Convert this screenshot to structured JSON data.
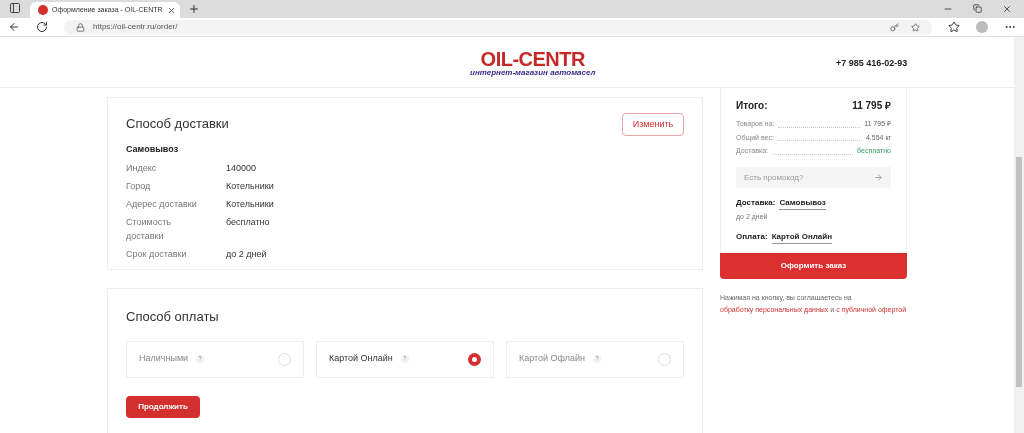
{
  "browser": {
    "tab_title": "Оформление заказа - OIL-CENTR",
    "url": "https://oil-centr.ru/order/"
  },
  "header": {
    "logo": "OIL-CENTR",
    "logo_tagline": "интернет-магазин автомасел",
    "phone": "+7 985 416-02-93"
  },
  "delivery": {
    "title": "Способ доставки",
    "change_button": "Изменить",
    "method": "Самовывоз",
    "rows": [
      {
        "label": "Индекс",
        "value": "140000"
      },
      {
        "label": "Город",
        "value": "Котельники"
      },
      {
        "label": "Адерес доставки",
        "value": "Котельники"
      },
      {
        "label": "Стоимость доставки",
        "value": "бесплатно"
      },
      {
        "label": "Срок доставки",
        "value": "до 2 дней"
      }
    ]
  },
  "payment": {
    "title": "Способ оплаты",
    "options": [
      {
        "label": "Наличными",
        "hint": "?",
        "selected": false
      },
      {
        "label": "Картой Онлайн",
        "hint": "?",
        "selected": true
      },
      {
        "label": "Картой Офлайн",
        "hint": "?",
        "selected": false
      }
    ],
    "continue_button": "Продолжить"
  },
  "summary": {
    "total_label": "Итого:",
    "total": "11 795 ₽",
    "lines": [
      {
        "label": "Товаров на:",
        "value": "11 795 ₽",
        "kind": "plain"
      },
      {
        "label": "Общий вес:",
        "value": "4.554 кг",
        "kind": "plain"
      },
      {
        "label": "Доставка:",
        "value": "бесплатно",
        "kind": "free"
      }
    ],
    "promo_placeholder": "Есть промокод?",
    "delivery_label": "Доставка:",
    "delivery_value": "Самовывоз",
    "delivery_term": "до 2 дней",
    "payment_label": "Оплата:",
    "payment_value": "Картой Онлайн",
    "order_button": "Оформить заказ",
    "consent_text": "Нажимая на кнопку, вы соглашаетесь на",
    "consent_link1": "обработку персональных данных",
    "consent_and": "и",
    "consent_link2": "с публичной офертой"
  }
}
